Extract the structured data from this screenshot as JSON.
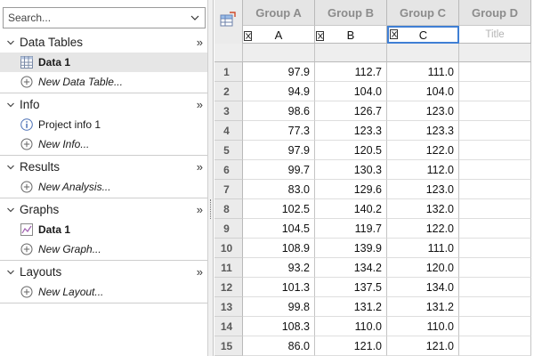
{
  "navigator": {
    "search_placeholder": "Search...",
    "more_glyph": "»",
    "sections": [
      {
        "title": "Data Tables",
        "items": [
          {
            "label": "Data 1",
            "icon": "data-table-icon",
            "bold": true,
            "italic": false,
            "selected": true
          },
          {
            "label": "New Data Table...",
            "icon": "add-circle-icon",
            "bold": false,
            "italic": true,
            "selected": false
          }
        ]
      },
      {
        "title": "Info",
        "items": [
          {
            "label": "Project info 1",
            "icon": "info-icon",
            "bold": false,
            "italic": false,
            "selected": false
          },
          {
            "label": "New Info...",
            "icon": "add-circle-icon",
            "bold": false,
            "italic": true,
            "selected": false
          }
        ]
      },
      {
        "title": "Results",
        "items": [
          {
            "label": "New Analysis...",
            "icon": "add-circle-icon",
            "bold": false,
            "italic": true,
            "selected": false
          }
        ]
      },
      {
        "title": "Graphs",
        "items": [
          {
            "label": "Data 1",
            "icon": "graph-icon",
            "bold": true,
            "italic": false,
            "selected": false
          },
          {
            "label": "New Graph...",
            "icon": "add-circle-icon",
            "bold": false,
            "italic": true,
            "selected": false
          }
        ]
      },
      {
        "title": "Layouts",
        "items": [
          {
            "label": "New Layout...",
            "icon": "add-circle-icon",
            "bold": false,
            "italic": true,
            "selected": false
          }
        ]
      }
    ]
  },
  "sheet": {
    "columns": [
      {
        "header": "Group A",
        "title": "A",
        "placeholder": false,
        "active": false
      },
      {
        "header": "Group B",
        "title": "B",
        "placeholder": false,
        "active": false
      },
      {
        "header": "Group C",
        "title": "C",
        "placeholder": false,
        "active": true
      },
      {
        "header": "Group D",
        "title": "Title",
        "placeholder": true,
        "active": false
      }
    ],
    "rows": [
      {
        "n": "1",
        "values": [
          "97.9",
          "112.7",
          "111.0",
          ""
        ]
      },
      {
        "n": "2",
        "values": [
          "94.9",
          "104.0",
          "104.0",
          ""
        ]
      },
      {
        "n": "3",
        "values": [
          "98.6",
          "126.7",
          "123.0",
          ""
        ]
      },
      {
        "n": "4",
        "values": [
          "77.3",
          "123.3",
          "123.3",
          ""
        ]
      },
      {
        "n": "5",
        "values": [
          "97.9",
          "120.5",
          "122.0",
          ""
        ]
      },
      {
        "n": "6",
        "values": [
          "99.7",
          "130.3",
          "112.0",
          ""
        ]
      },
      {
        "n": "7",
        "values": [
          "83.0",
          "129.6",
          "123.0",
          ""
        ]
      },
      {
        "n": "8",
        "values": [
          "102.5",
          "140.2",
          "132.0",
          ""
        ]
      },
      {
        "n": "9",
        "values": [
          "104.5",
          "119.7",
          "122.0",
          ""
        ]
      },
      {
        "n": "10",
        "values": [
          "108.9",
          "139.9",
          "111.0",
          ""
        ]
      },
      {
        "n": "11",
        "values": [
          "93.2",
          "134.2",
          "120.0",
          ""
        ]
      },
      {
        "n": "12",
        "values": [
          "101.3",
          "137.5",
          "134.0",
          ""
        ]
      },
      {
        "n": "13",
        "values": [
          "99.8",
          "131.2",
          "131.2",
          ""
        ]
      },
      {
        "n": "14",
        "values": [
          "108.3",
          "110.0",
          "110.0",
          ""
        ]
      },
      {
        "n": "15",
        "values": [
          "86.0",
          "121.0",
          "121.0",
          ""
        ]
      }
    ]
  },
  "colors": {
    "selection_border": "#3f7fd4",
    "header_text": "#8c8c8c",
    "header_bg": "#e5e5e5"
  }
}
